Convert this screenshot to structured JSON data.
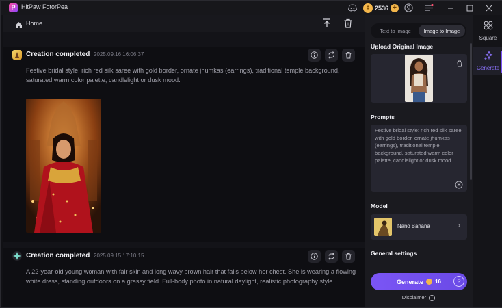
{
  "window": {
    "app_title": "HitPaw FotorPea",
    "coin_count": "2536",
    "icons": [
      "discord-icon",
      "coin-icon",
      "add-coins-icon",
      "account-icon",
      "menu-icon",
      "minimize-icon",
      "maximize-icon",
      "close-icon"
    ]
  },
  "nav": {
    "home_label": "Home"
  },
  "creations": [
    {
      "title": "Creation completed",
      "timestamp": "2025.09.16  16:06:37",
      "prompt": "Festive bridal style: rich red silk saree with gold border, ornate jhumkas (earrings), traditional temple background, saturated warm color palette, candlelight or dusk mood."
    },
    {
      "title": "Creation completed",
      "timestamp": "2025.09.15  17:10:15",
      "prompt": "A 22-year-old young woman with fair skin and long wavy brown hair that falls below her chest. She is wearing a flowing white dress, standing outdoors on a grassy field. Full-body photo in natural daylight, realistic photography style."
    }
  ],
  "panel": {
    "tabs": [
      {
        "label": "Text to Image",
        "active": false
      },
      {
        "label": "Image to Image",
        "active": true
      }
    ],
    "upload_label": "Upload Original Image",
    "prompts_label": "Prompts",
    "prompt_value": "Festive bridal style: rich red silk saree with gold border, ornate jhumkas (earrings), traditional temple background, saturated warm color palette, candlelight or dusk mood.",
    "model_label": "Model",
    "model_name": "Nano Banana",
    "general_settings_label": "General settings",
    "generate_label": "Generate",
    "generate_cost": "16",
    "disclaimer_label": "Disclaimer"
  },
  "rail": {
    "items": [
      {
        "label": "Square",
        "icon": "square-grid-icon",
        "active": false
      },
      {
        "label": "Generate",
        "icon": "sparkle-icon",
        "active": true
      }
    ]
  },
  "colors": {
    "accent": "#7b55f5",
    "coin": "#f3b64b",
    "background": "#111115"
  }
}
